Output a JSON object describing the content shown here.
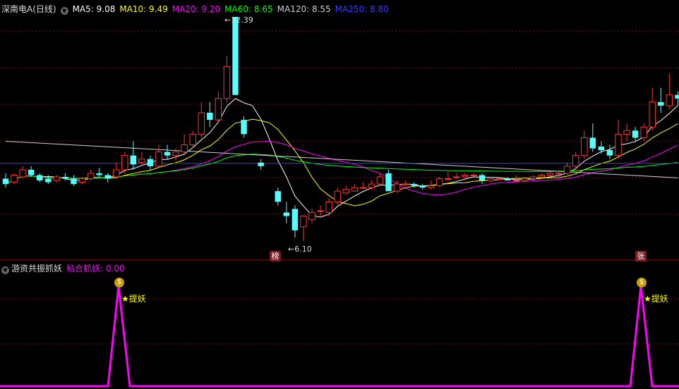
{
  "header": {
    "title": "深南电A(日线)",
    "ma": [
      {
        "label": "MA5: 9.08",
        "color": "#ffffff"
      },
      {
        "label": "MA10: 9.49",
        "color": "#ffff00"
      },
      {
        "label": "MA20: 9.20",
        "color": "#ff00ff"
      },
      {
        "label": "MA60: 8.65",
        "color": "#00ff00"
      },
      {
        "label": "MA120: 8.55",
        "color": "#d0d0d0"
      },
      {
        "label": "MA250: 8.80",
        "color": "#3a3aff"
      }
    ]
  },
  "annotations": {
    "high": "12.39",
    "low": "6.10",
    "badge_left": "榜",
    "badge_right": "张"
  },
  "indicator": {
    "title": "游资共振抓妖",
    "value_label": "粘合抓妖: 0.00",
    "value_color": "#ff00ff",
    "signal_text": "★提妖"
  },
  "chart_data": {
    "type": "candlestick",
    "up_color": "#ff3333",
    "down_color": "#54ffff",
    "high_value": 12.39,
    "low_value": 6.1,
    "candles": [
      [
        7.85,
        8.0,
        7.6,
        7.7
      ],
      [
        7.75,
        8.0,
        7.7,
        7.95
      ],
      [
        7.9,
        8.2,
        7.85,
        8.1
      ],
      [
        8.1,
        8.2,
        7.9,
        7.95
      ],
      [
        7.95,
        8.0,
        7.75,
        7.8
      ],
      [
        7.85,
        7.95,
        7.7,
        7.75
      ],
      [
        7.8,
        7.95,
        7.75,
        7.9
      ],
      [
        7.9,
        8.0,
        7.8,
        7.85
      ],
      [
        7.85,
        7.95,
        7.65,
        7.7
      ],
      [
        7.75,
        7.9,
        7.7,
        7.85
      ],
      [
        7.85,
        8.1,
        7.8,
        8.0
      ],
      [
        8.0,
        8.15,
        7.9,
        7.95
      ],
      [
        7.95,
        8.0,
        7.75,
        7.85
      ],
      [
        7.9,
        8.3,
        7.85,
        8.1
      ],
      [
        8.1,
        8.6,
        8.0,
        8.5
      ],
      [
        8.5,
        8.9,
        8.1,
        8.25
      ],
      [
        8.3,
        8.6,
        8.2,
        8.4
      ],
      [
        8.4,
        8.5,
        8.1,
        8.2
      ],
      [
        8.2,
        8.8,
        8.15,
        8.6
      ],
      [
        8.6,
        8.8,
        8.4,
        8.5
      ],
      [
        8.5,
        8.7,
        8.35,
        8.6
      ],
      [
        8.6,
        9.1,
        8.5,
        8.8
      ],
      [
        8.8,
        9.2,
        8.7,
        9.1
      ],
      [
        9.1,
        10.0,
        9.0,
        9.7
      ],
      [
        9.7,
        10.0,
        9.3,
        9.5
      ],
      [
        9.5,
        10.3,
        9.4,
        10.1
      ],
      [
        10.1,
        11.3,
        10.0,
        11.0
      ],
      [
        12.39,
        12.39,
        10.2,
        10.2
      ],
      [
        9.5,
        9.6,
        9.0,
        9.1
      ],
      [
        null,
        null,
        null,
        null
      ],
      [
        8.3,
        8.4,
        8.1,
        8.2
      ],
      [
        null,
        null,
        null,
        null
      ],
      [
        7.5,
        7.6,
        7.1,
        7.2
      ],
      [
        6.9,
        7.2,
        6.6,
        6.8
      ],
      [
        7.0,
        7.1,
        6.2,
        6.4
      ],
      [
        6.5,
        6.8,
        6.1,
        6.8
      ],
      [
        6.7,
        7.0,
        6.6,
        6.9
      ],
      [
        6.95,
        7.1,
        6.8,
        6.95
      ],
      [
        6.9,
        7.3,
        6.8,
        7.2
      ],
      [
        7.2,
        7.6,
        7.1,
        7.5
      ],
      [
        7.45,
        7.65,
        7.4,
        7.55
      ],
      [
        7.5,
        7.7,
        7.5,
        7.6
      ],
      [
        7.6,
        7.75,
        7.6,
        7.6
      ],
      [
        7.6,
        7.8,
        7.55,
        7.7
      ],
      [
        7.7,
        8.0,
        7.65,
        7.9
      ],
      [
        8.0,
        8.1,
        7.5,
        7.5
      ],
      [
        7.5,
        7.8,
        7.45,
        7.7
      ],
      [
        7.7,
        7.8,
        7.65,
        7.7
      ],
      [
        7.7,
        7.75,
        7.6,
        7.65
      ],
      [
        7.65,
        7.7,
        7.55,
        7.6
      ],
      [
        7.6,
        7.8,
        7.55,
        7.65
      ],
      [
        7.65,
        7.9,
        7.6,
        7.85
      ],
      [
        7.85,
        8.05,
        7.8,
        7.85
      ],
      [
        7.9,
        8.0,
        7.85,
        7.9
      ],
      [
        7.9,
        8.0,
        7.8,
        7.95
      ],
      [
        7.95,
        8.0,
        7.9,
        7.95
      ],
      [
        7.95,
        8.0,
        7.7,
        7.8
      ],
      [
        7.8,
        7.9,
        7.75,
        7.85
      ],
      [
        7.85,
        7.9,
        7.8,
        7.85
      ],
      [
        7.85,
        7.9,
        7.8,
        7.8
      ],
      [
        7.8,
        7.95,
        7.75,
        7.8
      ],
      [
        7.8,
        7.9,
        7.75,
        7.85
      ],
      [
        7.85,
        7.95,
        7.8,
        7.9
      ],
      [
        7.9,
        8.0,
        7.85,
        7.95
      ],
      [
        7.95,
        8.05,
        7.9,
        8.0
      ],
      [
        8.0,
        8.1,
        7.9,
        8.0
      ],
      [
        8.0,
        8.3,
        7.95,
        8.2
      ],
      [
        8.2,
        8.6,
        8.1,
        8.5
      ],
      [
        8.5,
        9.2,
        8.4,
        9.0
      ],
      [
        9.0,
        9.4,
        8.6,
        8.7
      ],
      [
        8.75,
        8.9,
        8.55,
        8.65
      ],
      [
        8.65,
        8.8,
        8.4,
        8.5
      ],
      [
        8.5,
        9.5,
        8.4,
        9.1
      ],
      [
        9.1,
        9.4,
        8.9,
        9.2
      ],
      [
        9.2,
        9.3,
        8.9,
        9.0
      ],
      [
        9.0,
        9.4,
        8.9,
        9.3
      ],
      [
        9.3,
        10.4,
        9.2,
        10.0
      ],
      [
        10.0,
        10.4,
        9.7,
        9.9
      ],
      [
        9.9,
        10.8,
        9.8,
        10.2
      ],
      [
        10.2,
        10.3,
        9.9,
        10.1
      ]
    ]
  }
}
